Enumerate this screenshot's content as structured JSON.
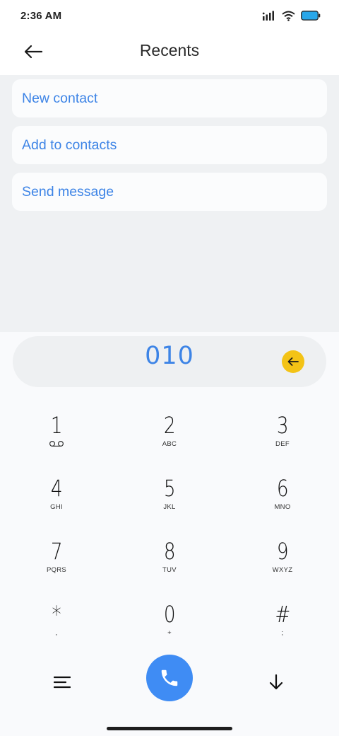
{
  "status_bar": {
    "time": "2:36 AM",
    "icons": [
      "signal-icon",
      "wifi-icon",
      "battery-icon"
    ]
  },
  "header": {
    "title": "Recents",
    "back_icon": "back-arrow-icon"
  },
  "actions": [
    {
      "label": "New contact"
    },
    {
      "label": "Add to contacts"
    },
    {
      "label": "Send message"
    }
  ],
  "dialer": {
    "number": "010",
    "backspace_icon": "backspace-arrow-icon",
    "keys": [
      {
        "digit": "1",
        "letters": ""
      },
      {
        "digit": "2",
        "letters": "ABC"
      },
      {
        "digit": "3",
        "letters": "DEF"
      },
      {
        "digit": "4",
        "letters": "GHI"
      },
      {
        "digit": "5",
        "letters": "JKL"
      },
      {
        "digit": "6",
        "letters": "MNO"
      },
      {
        "digit": "7",
        "letters": "PQRS"
      },
      {
        "digit": "8",
        "letters": "TUV"
      },
      {
        "digit": "9",
        "letters": "WXYZ"
      },
      {
        "digit": "*",
        "letters": ","
      },
      {
        "digit": "0",
        "letters": "+"
      },
      {
        "digit": "#",
        "letters": ";"
      }
    ]
  },
  "bottom_bar": {
    "menu_icon": "menu-icon",
    "call_icon": "phone-icon",
    "collapse_icon": "arrow-down-icon"
  },
  "colors": {
    "accent": "#3d84e6",
    "call_button": "#3f8cf4",
    "backspace": "#f3c316",
    "actions_bg": "#eff1f3"
  }
}
